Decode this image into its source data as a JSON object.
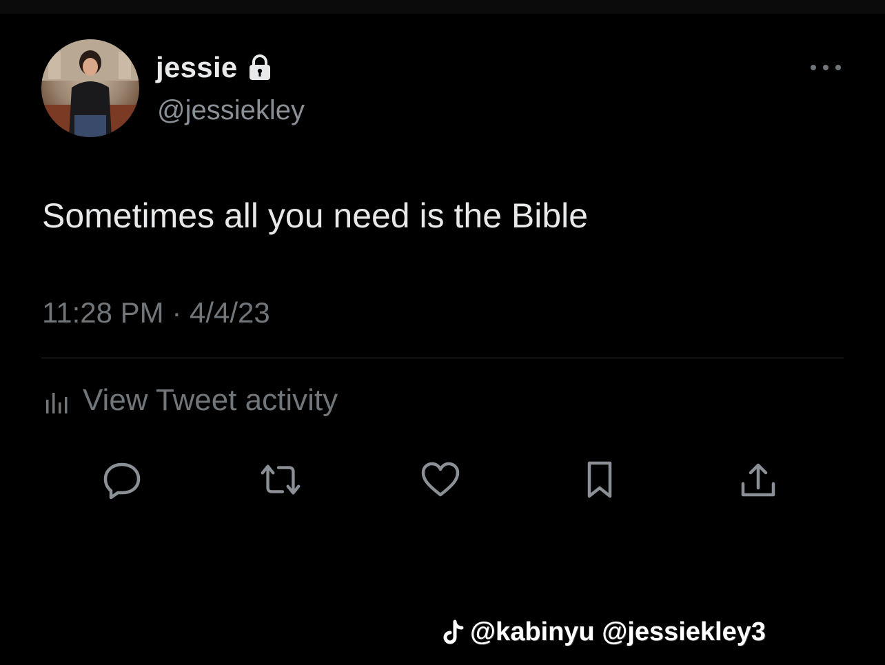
{
  "tweet": {
    "display_name": "jessie",
    "handle": "@jessiekley",
    "text": "Sometimes all you need is the Bible",
    "timestamp": "11:28 PM · 4/4/23",
    "view_activity_label": "View Tweet activity"
  },
  "icons": {
    "lock": "lock-icon",
    "more": "more-options-icon",
    "activity": "bar-chart-icon",
    "reply": "reply-icon",
    "retweet": "retweet-icon",
    "like": "heart-icon",
    "bookmark": "bookmark-icon",
    "share": "share-icon",
    "watermark": "tiktok-icon"
  },
  "watermark": {
    "text": "@kabinyu @jessiekley3"
  },
  "colors": {
    "background": "#000000",
    "primary_text": "#e7e9ea",
    "secondary_text": "#71767b",
    "divider": "#2f3336"
  }
}
